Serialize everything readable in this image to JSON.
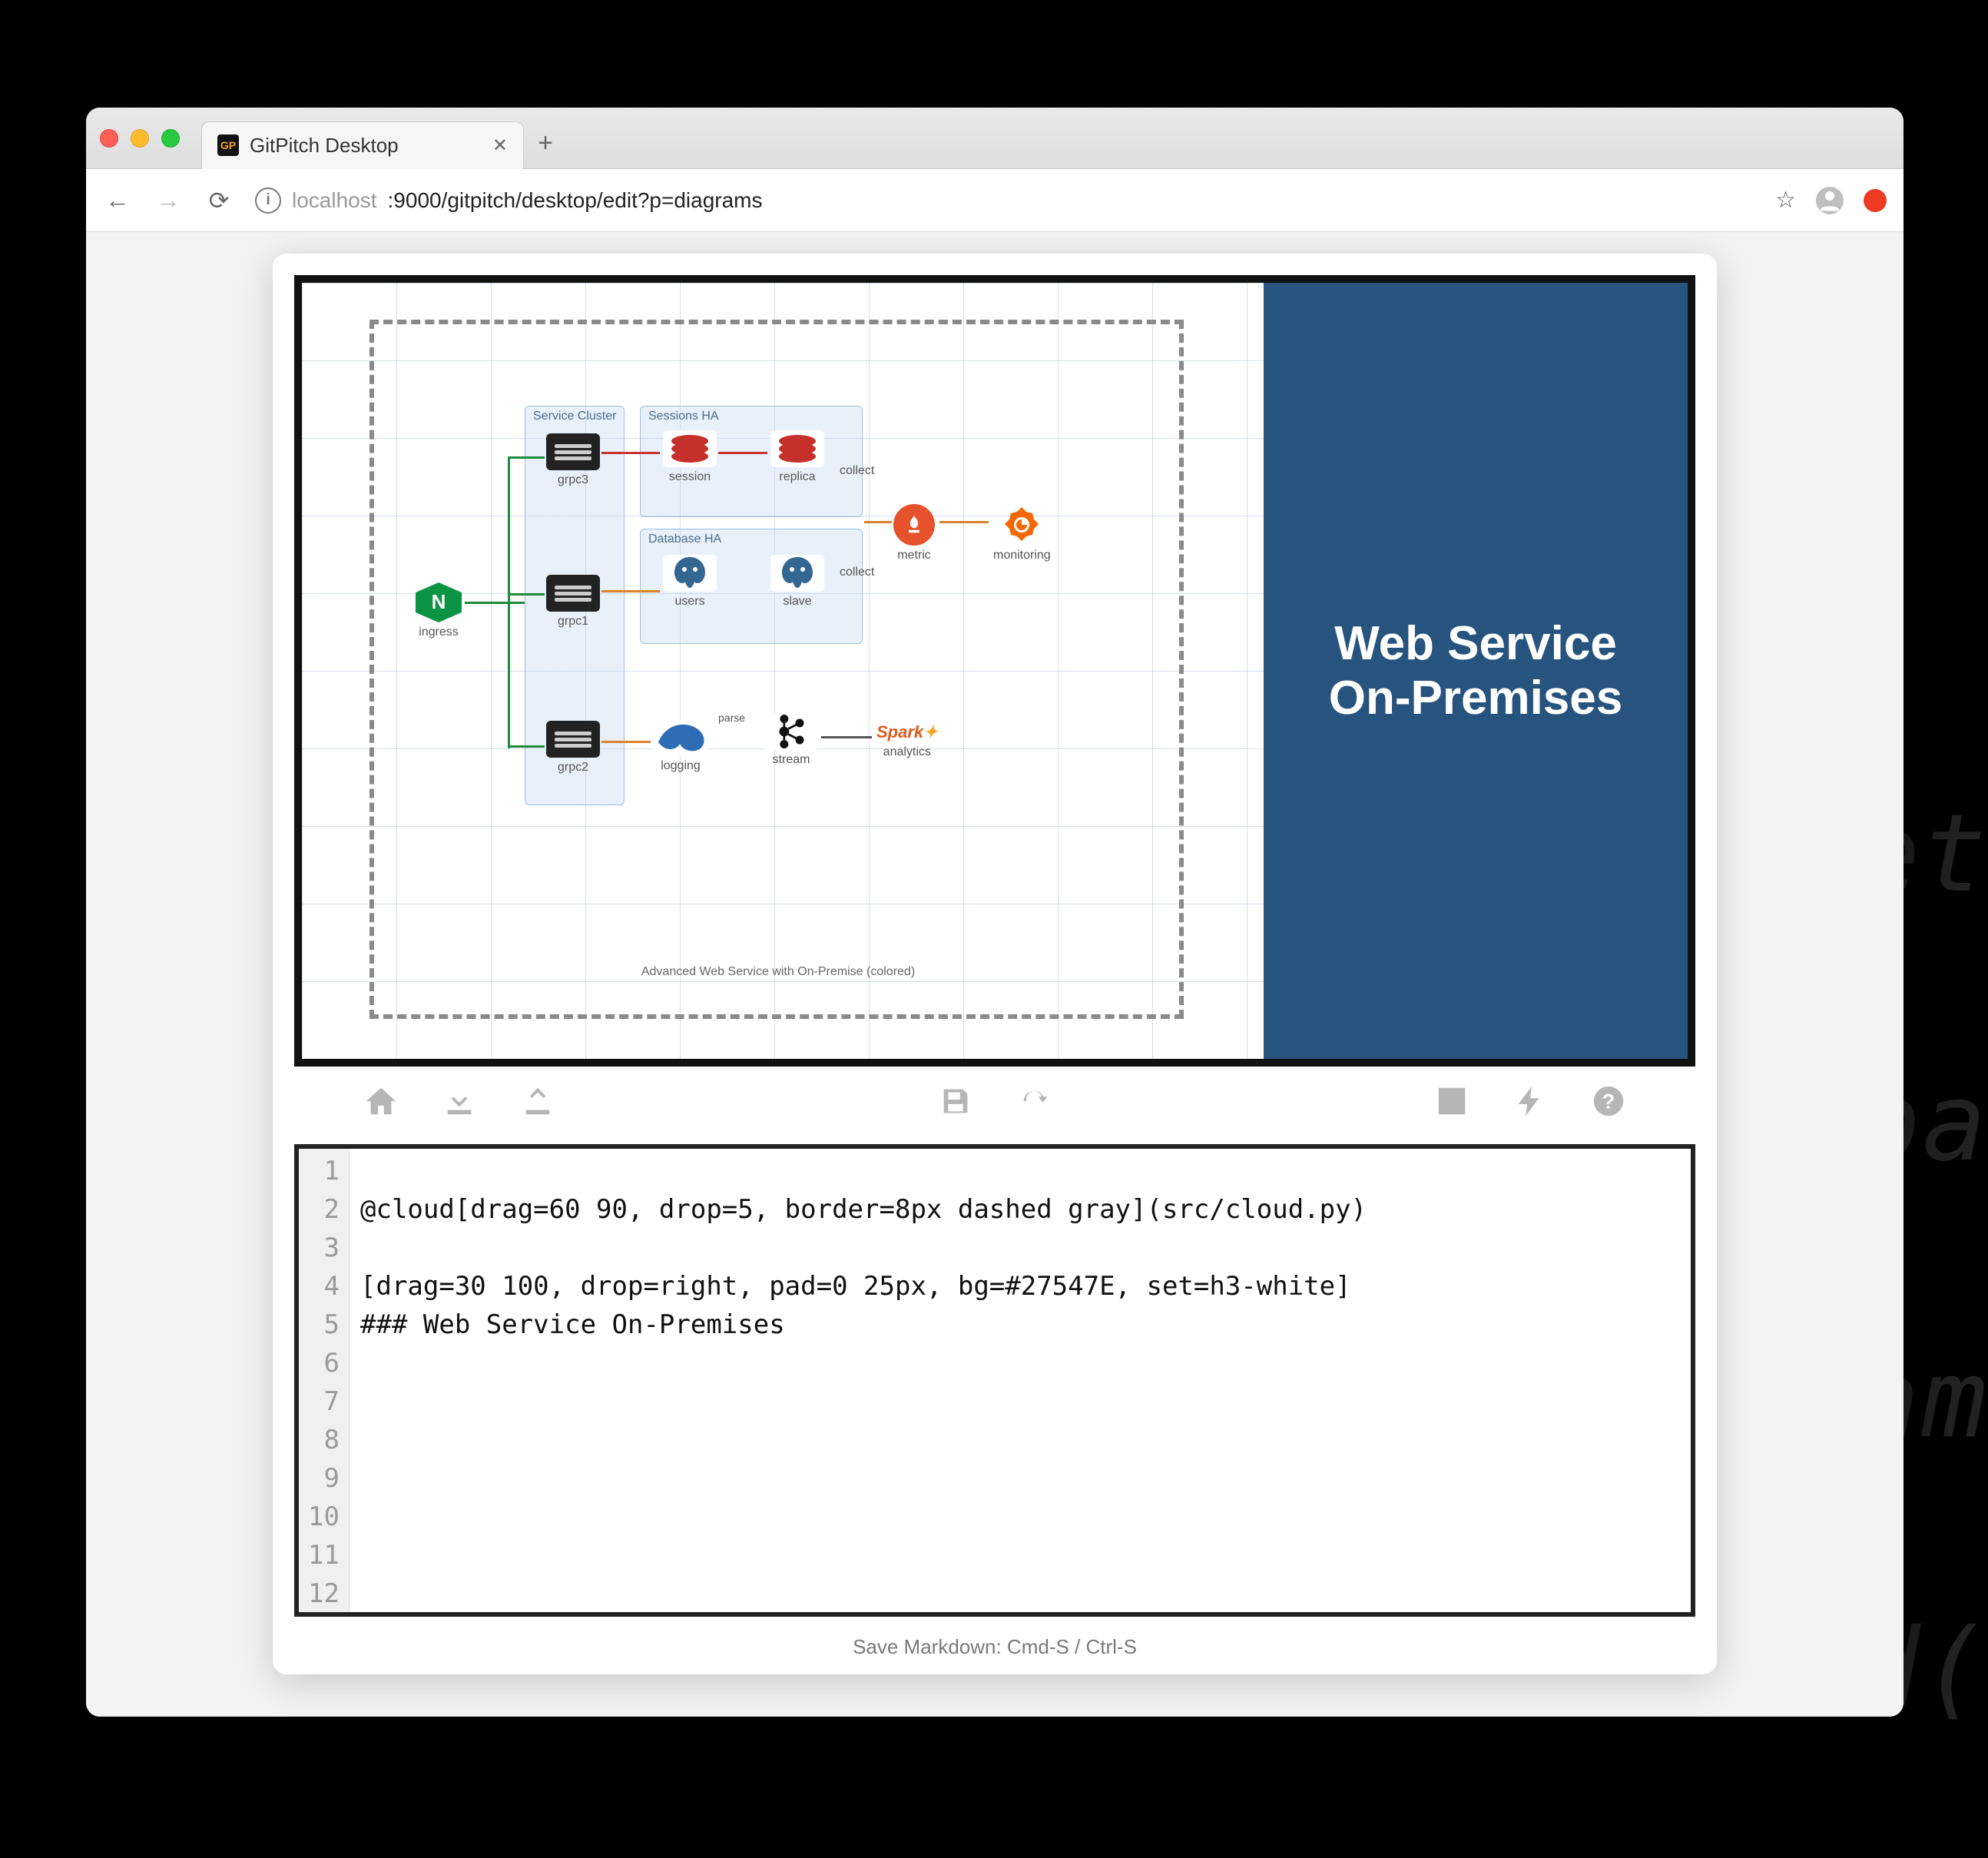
{
  "browser": {
    "tab_title": "GitPitch Desktop",
    "favicon_text": "GP",
    "url_host": "localhost",
    "url_port_path": ":9000/gitpitch/desktop/edit?p=diagrams"
  },
  "slide": {
    "right_heading": "Web Service On-Premises",
    "diagram_caption": "Advanced Web Service with On-Premise (colored)",
    "clusters": {
      "service_cluster": "Service Cluster",
      "sessions_ha": "Sessions HA",
      "database_ha": "Database HA"
    },
    "nodes": {
      "ingress": "ingress",
      "grpc1": "grpc1",
      "grpc2": "grpc2",
      "grpc3": "grpc3",
      "session": "session",
      "replica": "replica",
      "users": "users",
      "slave": "slave",
      "metric": "metric",
      "monitoring": "monitoring",
      "logging": "logging",
      "parse": "parse",
      "stream": "stream",
      "analytics": "analytics",
      "collect1": "collect",
      "collect2": "collect",
      "spark": "Spark"
    }
  },
  "toolbar": {
    "home": "Home",
    "download": "Download",
    "upload": "Upload",
    "save": "Save",
    "refresh": "Refresh",
    "expand": "Expand",
    "lightning": "Quick",
    "help": "Help"
  },
  "editor": {
    "lines": [
      "",
      "@cloud[drag=60 90, drop=5, border=8px dashed gray](src/cloud.py)",
      "",
      "[drag=30 100, drop=right, pad=0 25px, bg=#27547E, set=h3-white]",
      "### Web Service On-Premises",
      "",
      "",
      "",
      "",
      "",
      "",
      ""
    ]
  },
  "footer": {
    "hint": "Save Markdown: Cmd-S / Ctrl-S"
  },
  "bg_fragments": {
    "a": "et",
    "b": "pa",
    "c": "am",
    "d": "d("
  }
}
